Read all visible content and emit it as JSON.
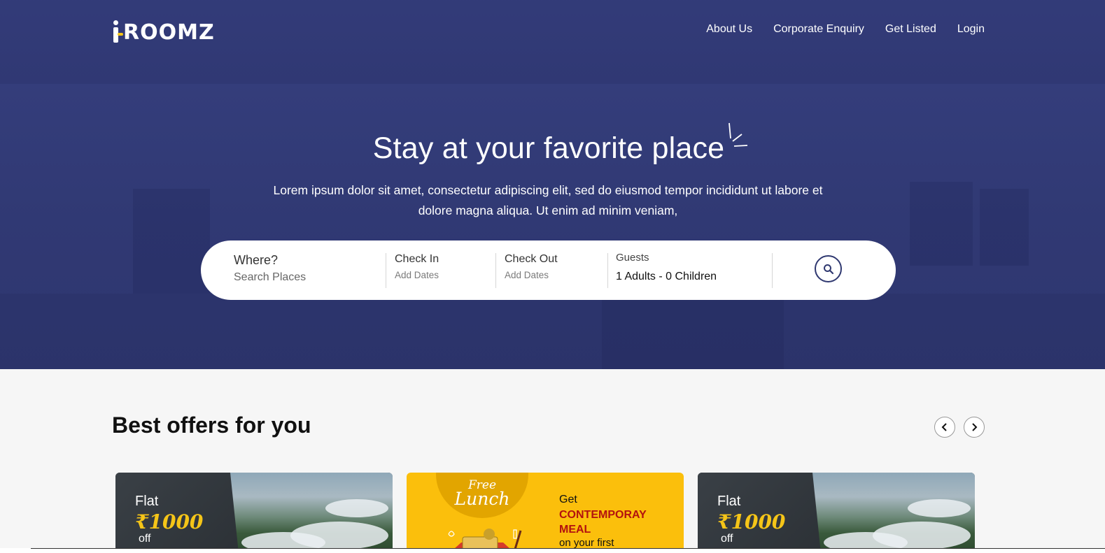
{
  "brand": {
    "logo_text": "ROOMZ",
    "logo_prefix": "i",
    "accent_color": "#f5c518",
    "hero_color": "#2f3870"
  },
  "nav": {
    "items": [
      {
        "label": "About Us"
      },
      {
        "label": "Corporate Enquiry"
      },
      {
        "label": "Get Listed"
      },
      {
        "label": "Login"
      }
    ]
  },
  "hero": {
    "title": "Stay at your favorite place",
    "subtitle": "Lorem ipsum dolor sit amet, consectetur adipiscing elit, sed do eiusmod tempor incididunt ut labore et dolore magna aliqua. Ut enim ad minim veniam,"
  },
  "search": {
    "where_label": "Where?",
    "where_placeholder": "Search Places",
    "checkin_label": "Check In",
    "checkin_placeholder": "Add Dates",
    "checkout_label": "Check Out",
    "checkout_placeholder": "Add Dates",
    "guests_label": "Guests",
    "guests_value": "1 Adults - 0 Children",
    "search_icon": "search-icon"
  },
  "offers": {
    "title": "Best offers for you",
    "prev_icon": "chevron-left-icon",
    "next_icon": "chevron-right-icon",
    "cards": [
      {
        "flat": "Flat",
        "amount": "₹1000",
        "off": "off"
      },
      {
        "free": "Free",
        "lunch": "Lunch",
        "get": "Get",
        "meal": "CONTEMPORAY MEAL",
        "first": "on your first"
      },
      {
        "flat": "Flat",
        "amount": "₹1000",
        "off": "off"
      }
    ]
  }
}
